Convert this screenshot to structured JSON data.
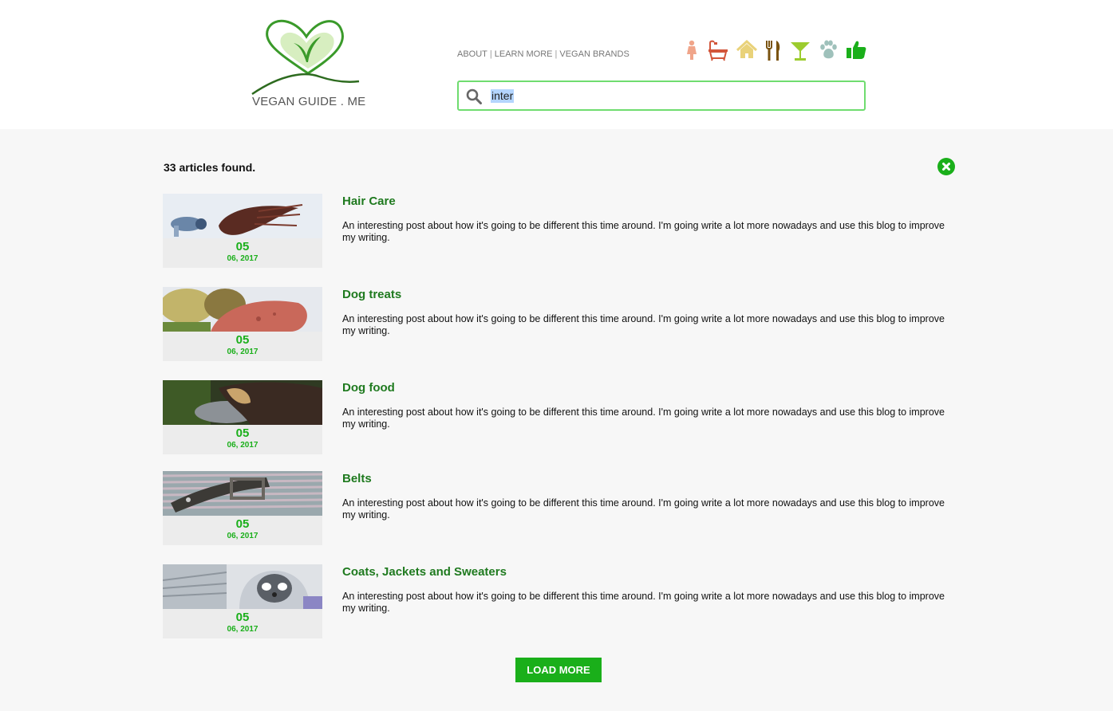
{
  "logo": {
    "text": "VEGAN GUIDE . ME"
  },
  "nav": {
    "about": "ABOUT",
    "learn_more": "LEARN MORE",
    "vegan_brands": "VEGAN BRANDS",
    "separator": "|"
  },
  "categories": [
    {
      "icon": "woman-icon",
      "color": "#f0a58a"
    },
    {
      "icon": "bathtub-icon",
      "color": "#d2553a"
    },
    {
      "icon": "house-icon",
      "color": "#e9d27a"
    },
    {
      "icon": "fork-knife-icon",
      "color": "#7a5310"
    },
    {
      "icon": "cocktail-icon",
      "color": "#9ccc2e"
    },
    {
      "icon": "paw-icon",
      "color": "#9fc1bb"
    },
    {
      "icon": "thumbs-up-icon",
      "color": "#1aaf1a"
    }
  ],
  "search": {
    "value": "inter"
  },
  "results": {
    "count_text": "33 articles found."
  },
  "articles": [
    {
      "title": "Hair Care",
      "day": "05",
      "month_year": "06, 2017",
      "excerpt": "An interesting post about how it's going to be different this time around. I'm going write a lot more nowadays and use this blog to improve my writing."
    },
    {
      "title": "Dog treats",
      "day": "05",
      "month_year": "06, 2017",
      "excerpt": "An interesting post about how it's going to be different this time around. I'm going write a lot more nowadays and use this blog to improve my writing."
    },
    {
      "title": "Dog food",
      "day": "05",
      "month_year": "06, 2017",
      "excerpt": "An interesting post about how it's going to be different this time around. I'm going write a lot more nowadays and use this blog to improve my writing."
    },
    {
      "title": "Belts",
      "day": "05",
      "month_year": "06, 2017",
      "excerpt": "An interesting post about how it's going to be different this time around. I'm going write a lot more nowadays and use this blog to improve my writing."
    },
    {
      "title": "Coats, Jackets and Sweaters",
      "day": "05",
      "month_year": "06, 2017",
      "excerpt": "An interesting post about how it's going to be different this time around. I'm going write a lot more nowadays and use this blog to improve my writing."
    }
  ],
  "load_more": {
    "label": "LOAD MORE"
  },
  "colors": {
    "accent": "#1aaf1a",
    "title": "#1f7a1f",
    "search_border": "#6fdc6f"
  }
}
